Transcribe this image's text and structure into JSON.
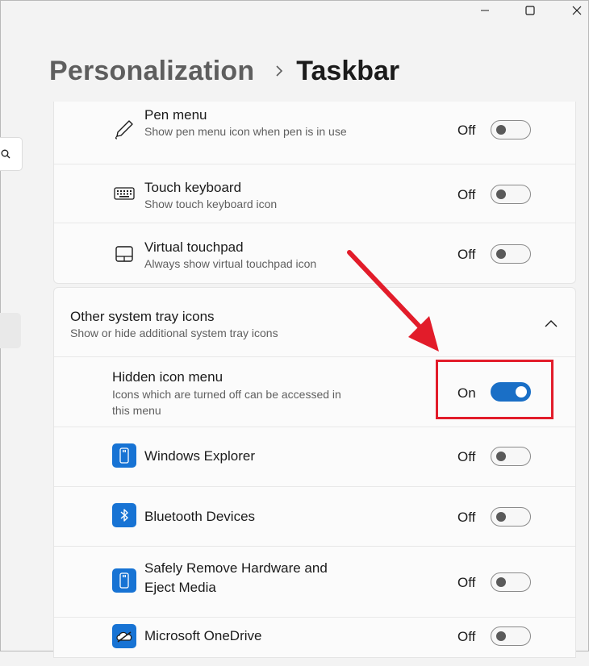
{
  "window": {
    "controls": [
      "minimize-icon",
      "maximize-icon",
      "close-icon"
    ]
  },
  "breadcrumb": {
    "parent": "Personalization",
    "separator_icon": "chevron-right-icon",
    "current": "Taskbar"
  },
  "sidebar": {
    "search_icon": "search-icon"
  },
  "taskbar_corner_icons": [
    {
      "icon": "pen-icon",
      "title": "Pen menu",
      "description": "Show pen menu icon when pen is in use",
      "state": "Off"
    },
    {
      "icon": "keyboard-icon",
      "title": "Touch keyboard",
      "description": "Show touch keyboard icon",
      "state": "Off"
    },
    {
      "icon": "touchpad-icon",
      "title": "Virtual touchpad",
      "description": "Always show virtual touchpad icon",
      "state": "Off"
    }
  ],
  "other_tray": {
    "title": "Other system tray icons",
    "description": "Show or hide additional system tray icons",
    "expand_icon": "chevron-up-icon",
    "hidden_menu": {
      "title": "Hidden icon menu",
      "description": "Icons which are turned off can be accessed in this menu",
      "state": "On"
    },
    "apps": [
      {
        "icon": "usb-drive-icon",
        "title": "Windows Explorer",
        "state": "Off"
      },
      {
        "icon": "bluetooth-icon",
        "title": "Bluetooth Devices",
        "state": "Off"
      },
      {
        "icon": "usb-drive-icon",
        "title": "Safely Remove Hardware and Eject Media",
        "state": "Off"
      },
      {
        "icon": "onedrive-cloud-icon",
        "title": "Microsoft OneDrive",
        "state": "Off"
      }
    ]
  },
  "colors": {
    "accent": "#1a6fc6",
    "annotation": "#e21c2a",
    "app_icon_bg": "#1773d4"
  }
}
